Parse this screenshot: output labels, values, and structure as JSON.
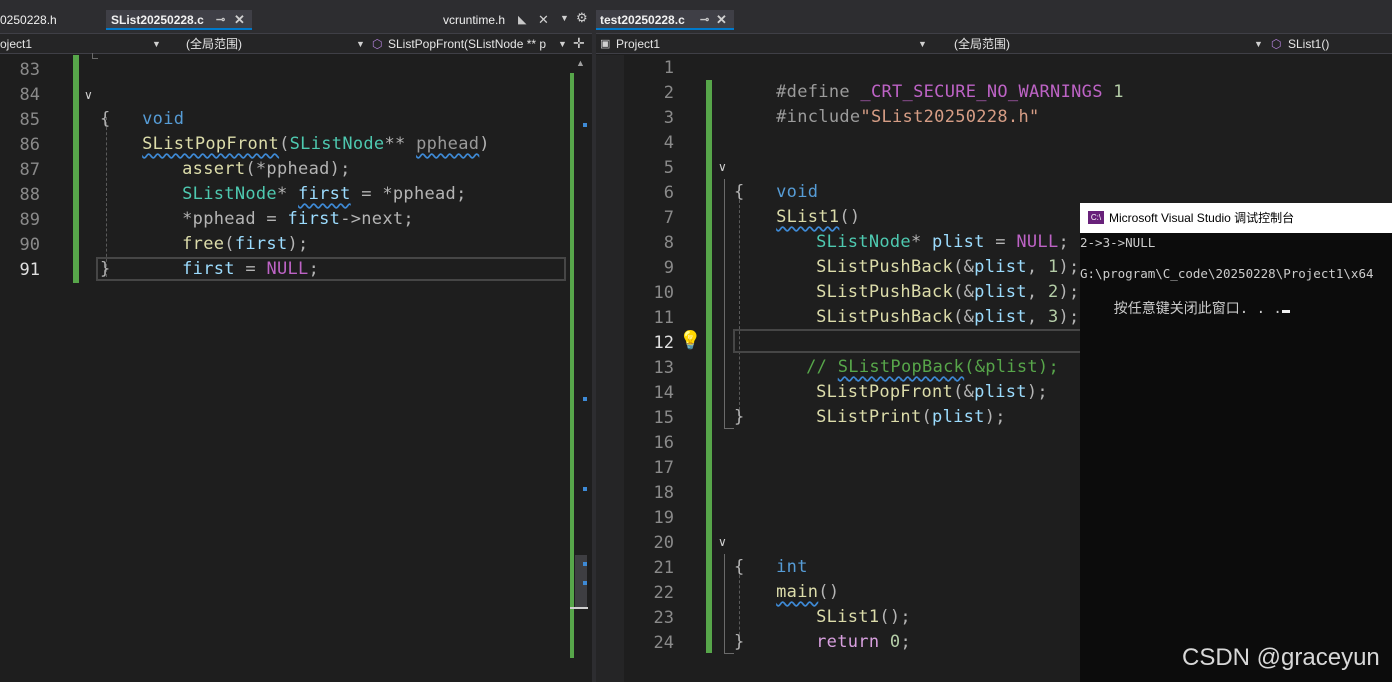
{
  "left_tabs": {
    "tab1": "0250228.h",
    "tab2": "SList20250228.c",
    "tab3": "vcruntime.h"
  },
  "right_tabs": {
    "tab1": "test20250228.c"
  },
  "left_nav": {
    "project": "oject1",
    "scope": "(全局范围)",
    "member": "SListPopFront(SListNode ** p"
  },
  "right_nav": {
    "project": "Project1",
    "scope": "(全局范围)",
    "member": "SList1()"
  },
  "left_lines": [
    "83",
    "84",
    "85",
    "86",
    "87",
    "88",
    "89",
    "90",
    "91"
  ],
  "left_code": {
    "l84_kw": "void",
    "l84_fn": "SListPopFront",
    "l84_p1": "(",
    "l84_ty": "SListNode",
    "l84_p2": "** ",
    "l84_pa": "pphead",
    "l84_p3": ")",
    "l85": "{",
    "l86_fn": "assert",
    "l86_rest": "(*pphead);",
    "l87_ty": "SListNode",
    "l87_p1": "* ",
    "l87_va": "first",
    "l87_p2": " = *pphead;",
    "l88_p1": "*pphead = ",
    "l88_va": "first",
    "l88_p2": "->next;",
    "l89_fn": "free",
    "l89_p1": "(",
    "l89_va": "first",
    "l89_p2": ");",
    "l90_va": "first",
    "l90_p1": " = ",
    "l90_mac": "NULL",
    "l90_p2": ";",
    "l91": "}"
  },
  "right_lines": [
    "1",
    "2",
    "3",
    "4",
    "5",
    "6",
    "7",
    "8",
    "9",
    "10",
    "11",
    "12",
    "13",
    "14",
    "15",
    "16",
    "17",
    "18",
    "19",
    "20",
    "21",
    "22",
    "23",
    "24"
  ],
  "right_code": {
    "l1_pp": "#define ",
    "l1_mac": "_CRT_SECURE_NO_WARNINGS",
    "l1_nm": " 1",
    "l2_pp": "#include",
    "l2_st": "\"SList20250228.h\"",
    "l5_kw": "void",
    "l5_fn": "SList1",
    "l5_p": "()",
    "l6": "{",
    "l7_ty": "SListNode",
    "l7_p1": "* ",
    "l7_va": "plist",
    "l7_p2": " = ",
    "l7_mac": "NULL",
    "l7_p3": ";",
    "l8_fn": "SListPushBack",
    "l8_p1": "(&",
    "l8_va": "plist",
    "l8_p2": ", ",
    "l8_nm": "1",
    "l8_p3": ");",
    "l9_fn": "SListPushBack",
    "l9_p1": "(&",
    "l9_va": "plist",
    "l9_p2": ", ",
    "l9_nm": "2",
    "l9_p3": ");",
    "l10_fn": "SListPushBack",
    "l10_p1": "(&",
    "l10_va": "plist",
    "l10_p2": ", ",
    "l10_nm": "3",
    "l10_p3": ");",
    "l12_cm1": "// ",
    "l12_cm2": "SListPopBack",
    "l12_cm3": "(&plist);",
    "l13_fn": "SListPopFront",
    "l13_p1": "(&",
    "l13_va": "plist",
    "l13_p2": ");",
    "l14_fn": "SListPrint",
    "l14_p1": "(",
    "l14_va": "plist",
    "l14_p2": ");",
    "l15": "}",
    "l20_kw": "int",
    "l20_fn": "main",
    "l20_p": "()",
    "l21": "{",
    "l22_fn": "SList1",
    "l22_p": "();",
    "l23_kw": "return",
    "l23_nm": " 0",
    "l23_p": ";",
    "l24": "}"
  },
  "console": {
    "title": "Microsoft Visual Studio 调试控制台",
    "line1": "2->3->NULL",
    "line2": "G:\\program\\C_code\\20250228\\Project1\\x64",
    "line3": "按任意键关闭此窗口. . ."
  },
  "watermark": "CSDN @graceyun",
  "colors": {
    "editor_bg": "#1e1e1e",
    "change_bar": "#57a64a",
    "keyword": "#569cd6",
    "function": "#dcdcaa",
    "type": "#4ec9b0",
    "macro": "#bd63c5",
    "comment": "#57a64a",
    "string": "#d69d85"
  }
}
